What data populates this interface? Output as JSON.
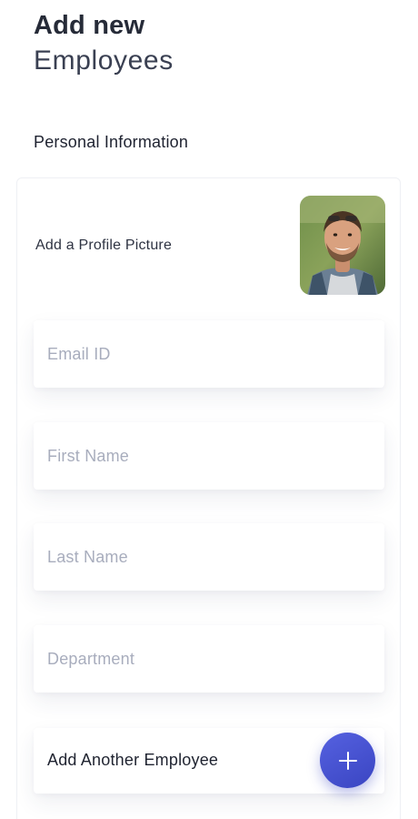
{
  "header": {
    "title_bold": "Add new",
    "title_light": "Employees"
  },
  "section": {
    "title": "Personal Information"
  },
  "profile": {
    "label": "Add a Profile Picture",
    "avatar_icon": "profile-photo"
  },
  "form": {
    "email_placeholder": "Email ID",
    "first_name_placeholder": "First Name",
    "last_name_placeholder": "Last Name",
    "department_placeholder": "Department",
    "email_value": "",
    "first_name_value": "",
    "last_name_value": "",
    "department_value": ""
  },
  "add_another": {
    "label": "Add Another Employee",
    "icon": "plus-icon"
  },
  "colors": {
    "accent": "#4450d4",
    "title": "#262b38",
    "placeholder": "#a8adbd"
  }
}
